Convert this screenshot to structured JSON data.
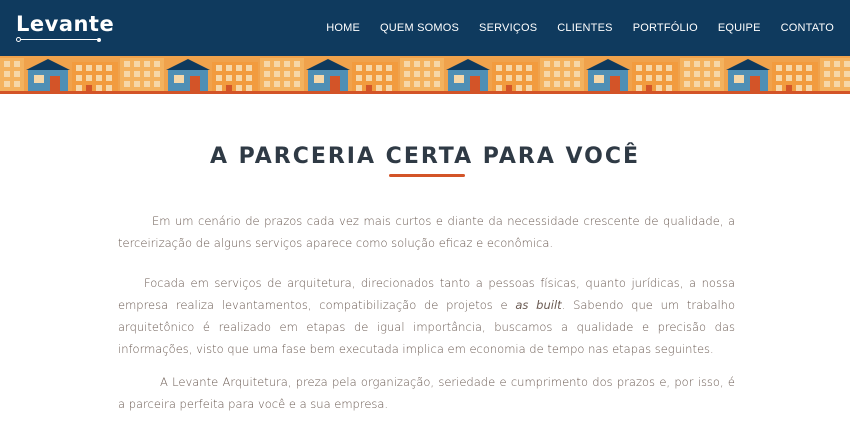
{
  "header": {
    "logo_text": "Levante",
    "nav": [
      "HOME",
      "QUEM SOMOS",
      "SERVIÇOS",
      "CLIENTES",
      "PORTFÓLIO",
      "EQUIPE",
      "CONTATO"
    ]
  },
  "main": {
    "headline": "A PARCERIA CERTA PARA VOCÊ",
    "paragraphs": {
      "p1": "Em um cenário de prazos cada vez mais curtos e diante da necessidade crescente de qualidade, a terceirização de alguns serviços aparece como solução eficaz e econômica.",
      "p2_before": "Focada em serviços de arquitetura, direcionados tanto a pessoas físicas, quanto jurídicas, a nossa empresa realiza levantamentos, compatibilização de projetos e ",
      "p2_italic": "as built",
      "p2_after": ". Sabendo que um trabalho arquitetônico é realizado em etapas de igual importância, buscamos a qualidade e precisão das informações, visto que uma fase bem executada implica em economia de tempo nas etapas seguintes.",
      "p3": "A Levante Arquitetura, preza pela organização, seriedade e cumprimento dos prazos e, por isso, é a parceira perfeita para você e a sua empresa."
    }
  },
  "colors": {
    "header_bg": "#0f3a5e",
    "accent": "#d35428",
    "banner_orange": "#f0a24c",
    "banner_blue": "#4f8fb5"
  }
}
